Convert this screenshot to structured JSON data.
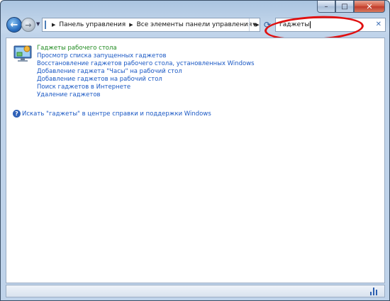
{
  "window": {
    "caption": {
      "minimize": "–",
      "maximize": "□",
      "close": "✕"
    }
  },
  "nav": {
    "back_icon": "←",
    "forward_icon": "→",
    "breadcrumb": [
      "Панель управления",
      "Все элементы панели управления"
    ],
    "refresh_icon": "⟳"
  },
  "search": {
    "value": "гаджеты",
    "clear_icon": "✕"
  },
  "results": {
    "title": "Гаджеты рабочего стола",
    "links": [
      "Просмотр списка запущенных гаджетов",
      "Восстановление гаджетов рабочего стола, установленных Windows",
      "Добавление гаджета \"Часы\" на рабочий стол",
      "Добавление гаджетов на рабочий стол",
      "Поиск гаджетов в Интернете",
      "Удаление гаджетов"
    ]
  },
  "help": {
    "icon": "?",
    "text": "Искать \"гаджеты\" в центре справки и поддержки Windows"
  },
  "colors": {
    "title_green": "#1e8a1e",
    "link_blue": "#1a58c4",
    "annotation_red": "#e01010"
  }
}
